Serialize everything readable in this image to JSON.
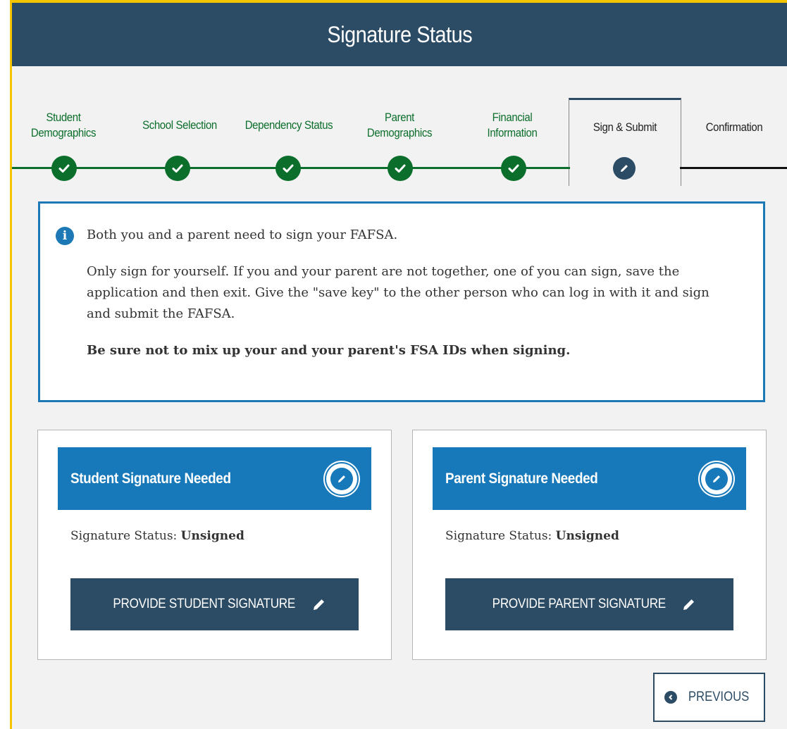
{
  "header": {
    "title": "Signature Status"
  },
  "stepper": {
    "steps": [
      {
        "label_line1": "Student",
        "label_line2": "Demographics",
        "state": "complete"
      },
      {
        "label_line1": "School Selection",
        "label_line2": "",
        "state": "complete"
      },
      {
        "label_line1": "Dependency Status",
        "label_line2": "",
        "state": "complete"
      },
      {
        "label_line1": "Parent",
        "label_line2": "Demographics",
        "state": "complete"
      },
      {
        "label_line1": "Financial",
        "label_line2": "Information",
        "state": "complete"
      },
      {
        "label_line1": "Sign & Submit",
        "label_line2": "",
        "state": "active"
      },
      {
        "label_line1": "Confirmation",
        "label_line2": "",
        "state": "upcoming"
      }
    ],
    "complete_icon": "check-icon",
    "active_icon": "pencil-icon"
  },
  "info": {
    "icon": "info-icon",
    "line1": "Both you and a parent need to sign your FAFSA.",
    "line2": "Only sign for yourself. If you and your parent are not together, one of you can sign, save the application and then exit. Give the \"save key\" to the other person who can log in with it and sign and submit the FAFSA.",
    "line3": "Be sure not to mix up your and your parent's FSA IDs when signing."
  },
  "student_card": {
    "title": "Student Signature Needed",
    "status_label": "Signature Status: ",
    "status_value": "Unsigned",
    "button_label": "PROVIDE STUDENT SIGNATURE"
  },
  "parent_card": {
    "title": "Parent Signature Needed",
    "status_label": "Signature Status: ",
    "status_value": "Unsigned",
    "button_label": "PROVIDE PARENT SIGNATURE"
  },
  "previous_button": {
    "label": "PREVIOUS"
  },
  "colors": {
    "header_bg": "#2c4c66",
    "step_complete": "#0b6e2b",
    "info_border": "#1d79b5",
    "card_head": "#1779ba",
    "accent_border": "#f2c500"
  }
}
